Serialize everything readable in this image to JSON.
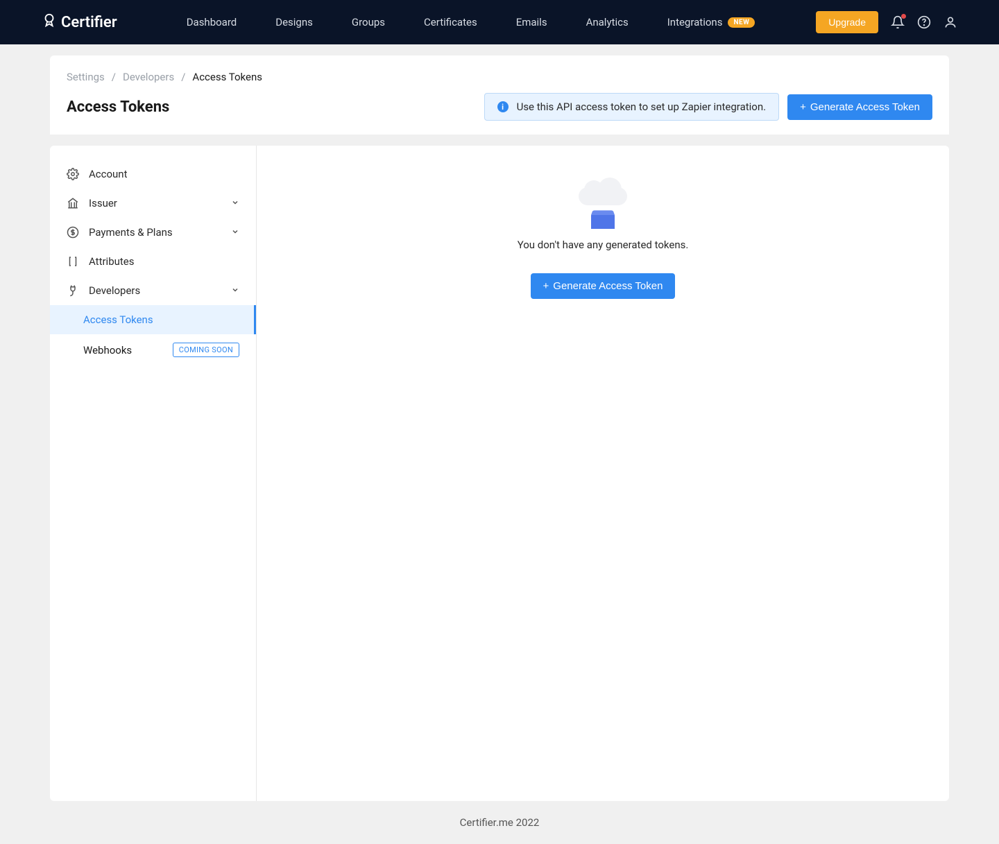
{
  "brand": "Certifier",
  "nav": {
    "items": [
      "Dashboard",
      "Designs",
      "Groups",
      "Certificates",
      "Emails",
      "Analytics"
    ],
    "integrations_label": "Integrations",
    "integrations_badge": "NEW",
    "upgrade_label": "Upgrade"
  },
  "breadcrumb": {
    "a": "Settings",
    "b": "Developers",
    "c": "Access Tokens"
  },
  "page_title": "Access Tokens",
  "info_banner": "Use this API access token to set up Zapier integration.",
  "buttons": {
    "generate": "Generate Access Token"
  },
  "sidebar": {
    "account": "Account",
    "issuer": "Issuer",
    "payments": "Payments & Plans",
    "attributes": "Attributes",
    "developers": "Developers",
    "access_tokens": "Access Tokens",
    "webhooks": "Webhooks",
    "coming_soon": "COMING SOON"
  },
  "empty_state": "You don't have any generated tokens.",
  "footer": "Certifier.me 2022"
}
